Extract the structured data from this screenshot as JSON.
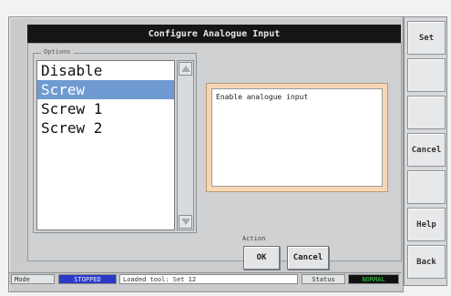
{
  "dialog": {
    "title": "Configure Analogue Input",
    "options_legend": "Options",
    "options": [
      "Disable",
      "Screw",
      "Screw 1",
      "Screw 2"
    ],
    "selected_index": 1,
    "description": "Enable analogue input",
    "action_legend": "Action",
    "ok_label": "OK",
    "cancel_label": "Cancel"
  },
  "sidebar": {
    "buttons": [
      "Set",
      "",
      "",
      "Cancel",
      "",
      "Help",
      "Back"
    ]
  },
  "status_bar": {
    "mode_label": "Mode",
    "mode_value": "STOPPED",
    "message": "Loaded tool: Set 12",
    "status_label": "Status",
    "status_value": "NORMAL"
  },
  "colors": {
    "selection": "#6f9ad2",
    "title_bar": "#151515",
    "mode_badge": "#2c39c8",
    "status_badge": "#1f9a2a",
    "description_frame": "#f7d7b3"
  }
}
